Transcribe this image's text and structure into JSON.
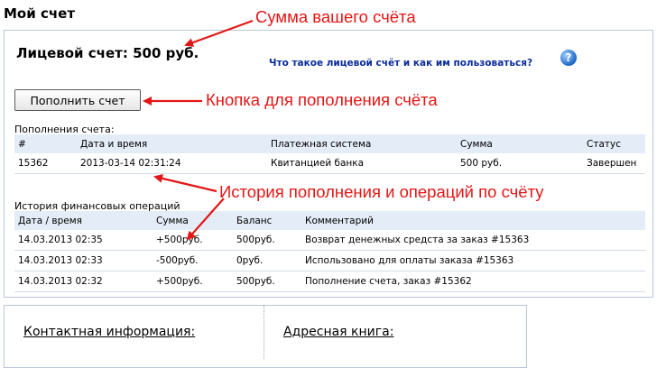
{
  "page": {
    "title": "Мой счет"
  },
  "account": {
    "balance_label": "Лицевой счет: 500 руб.",
    "help_link": "Что такое лицевой счёт и как им пользоваться?",
    "help_icon": "?",
    "topup_button": "Пополнить счет"
  },
  "topups": {
    "title": "Пополнения счета:",
    "headers": [
      "#",
      "Дата и время",
      "Платежная система",
      "Сумма",
      "Статус"
    ],
    "rows": [
      [
        "15362",
        "2013-03-14 02:31:24",
        "Квитанцией банка",
        "500 руб.",
        "Завершен"
      ]
    ]
  },
  "history": {
    "title": "История финансовых операций",
    "headers": [
      "Дата / время",
      "Сумма",
      "Баланс",
      "Комментарий"
    ],
    "rows": [
      [
        "14.03.2013 02:35",
        "+500руб.",
        "500руб.",
        "Возврат денежных средста за заказ #15363"
      ],
      [
        "14.03.2013 02:33",
        "-500руб.",
        "0руб.",
        "Использовано для оплаты заказа #15363"
      ],
      [
        "14.03.2013 02:32",
        "+500руб.",
        "500руб.",
        "Пополнение счета, заказ #15362"
      ]
    ]
  },
  "annotations": {
    "balance": "Сумма вашего счёта",
    "button": "Кнопка для пополнения счёта",
    "history": "История пополнения и операций по счёту",
    "color": "#e31616"
  },
  "bottom": {
    "contacts": "Контактная информация:",
    "addressbook": "Адресная книга:"
  }
}
